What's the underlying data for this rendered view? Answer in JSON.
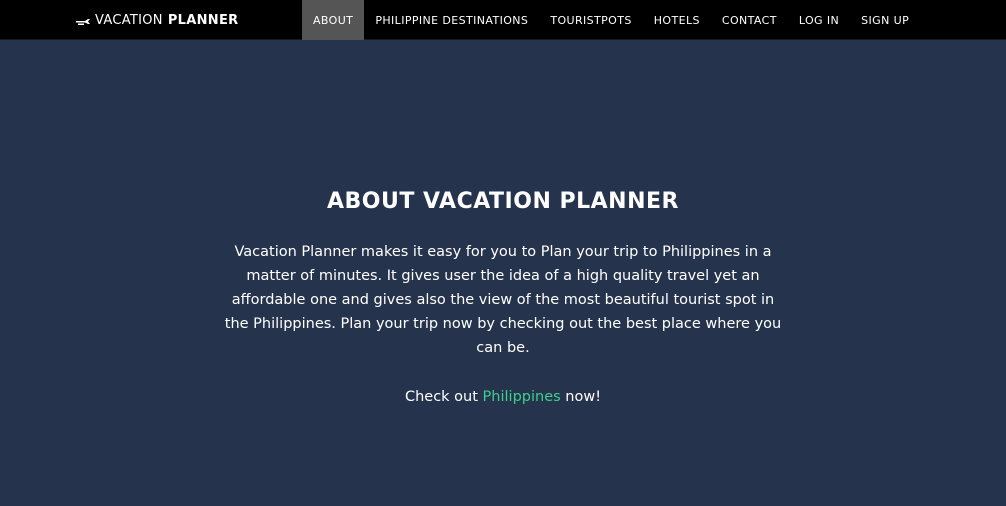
{
  "brand": {
    "icon": "airplane-icon",
    "name_part1": "VACATION",
    "name_part2": "PLANNER"
  },
  "nav": {
    "items": [
      {
        "label": "ABOUT",
        "active": true
      },
      {
        "label": "PHILIPPINE DESTINATIONS",
        "active": false
      },
      {
        "label": "TOURISTPOTS",
        "active": false
      },
      {
        "label": "HOTELS",
        "active": false
      },
      {
        "label": "CONTACT",
        "active": false
      },
      {
        "label": "LOG IN",
        "active": false
      },
      {
        "label": "SIGN UP",
        "active": false
      }
    ]
  },
  "about": {
    "title": "ABOUT VACATION PLANNER",
    "description": "Vacation Planner makes it easy for you to Plan your trip to Philippines in a matter of minutes. It gives user the idea of a high quality travel yet an affordable one and gives also the view of the most beautiful tourist spot in the Philippines. Plan your trip now by checking out the best place where you can be.",
    "cta_prefix": "Check out ",
    "cta_link": "Philippines",
    "cta_suffix": " now!"
  },
  "colors": {
    "background": "#26334d",
    "navbar": "#000000",
    "active_nav": "#555555",
    "link": "#3ecf8e"
  }
}
